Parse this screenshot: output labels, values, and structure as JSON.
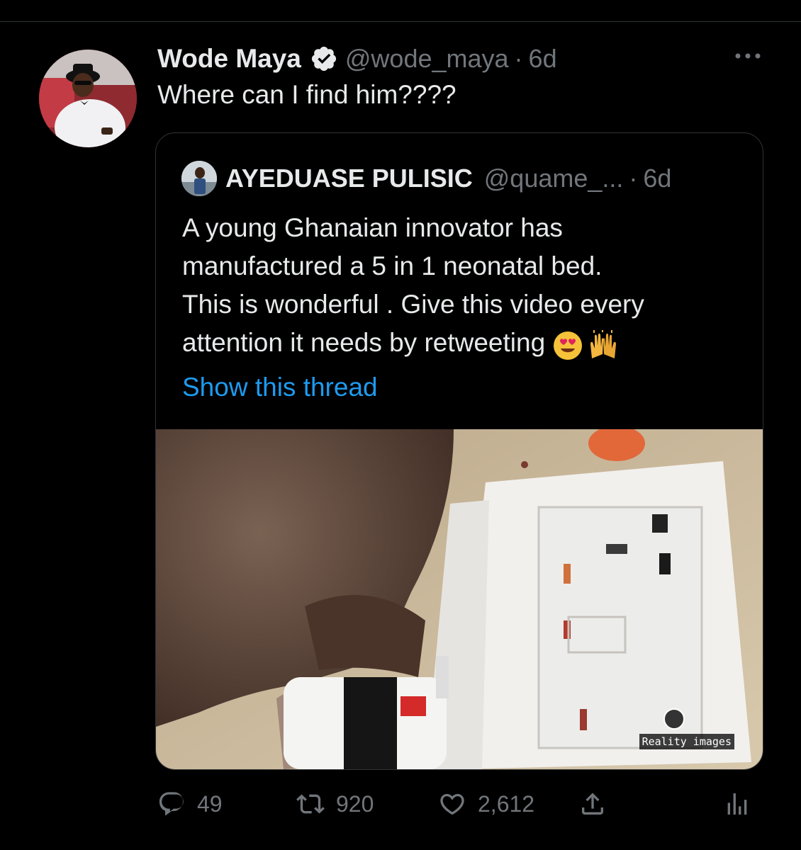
{
  "tweet": {
    "author_name": "Wode Maya",
    "handle": "@wode_maya",
    "separator": "·",
    "time": "6d",
    "text": "Where can I find him????"
  },
  "quoted": {
    "author_name": "AYEDUASE PULISIC",
    "handle": "@quame_...",
    "separator": "·",
    "time": "6d",
    "lines": [
      "A young Ghanaian innovator has",
      "manufactured a 5 in 1 neonatal bed.",
      "This is wonderful . Give this video every",
      "attention it needs by retweeting"
    ],
    "emojis": [
      "heart-eyes-emoji",
      "raising-hands-emoji"
    ],
    "show_thread": "Show this thread",
    "media_watermark": "Reality images"
  },
  "actions": {
    "replies": "49",
    "retweets": "920",
    "likes": "2,612"
  },
  "colors": {
    "background": "#000000",
    "text": "#e7e9ea",
    "secondary": "#71767b",
    "link": "#1d9bf0",
    "border": "#2f3336"
  }
}
